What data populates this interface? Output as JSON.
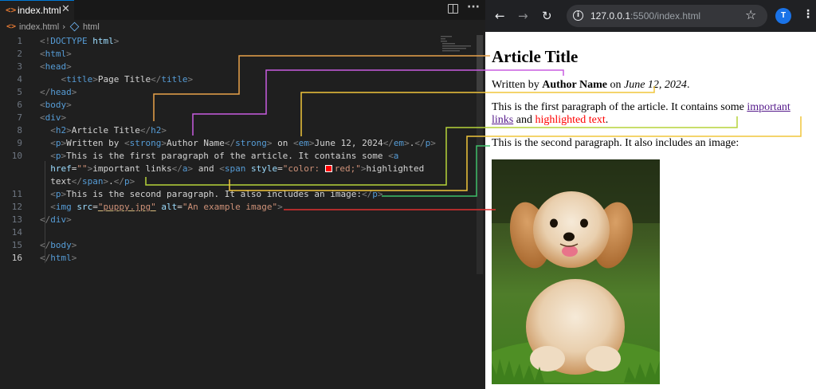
{
  "editor": {
    "tab": {
      "label": "index.html",
      "icon": "html-file-icon",
      "close": "✕"
    },
    "breadcrumb": {
      "file": "index.html",
      "separator": "›",
      "element": "html"
    },
    "lines": [
      {
        "num": "1",
        "parts": [
          [
            "br",
            "<!"
          ],
          [
            "tg",
            "DOCTYPE"
          ],
          [
            "tx",
            " "
          ],
          [
            "at",
            "html"
          ],
          [
            "br",
            ">"
          ]
        ]
      },
      {
        "num": "2",
        "parts": [
          [
            "br",
            "<"
          ],
          [
            "tg",
            "html"
          ],
          [
            "br",
            ">"
          ]
        ]
      },
      {
        "num": "3",
        "parts": [
          [
            "br",
            "<"
          ],
          [
            "tg",
            "head"
          ],
          [
            "br",
            ">"
          ]
        ]
      },
      {
        "num": "4",
        "parts": [
          [
            "tx",
            "    "
          ],
          [
            "br",
            "<"
          ],
          [
            "tg",
            "title"
          ],
          [
            "br",
            ">"
          ],
          [
            "tx",
            "Page Title"
          ],
          [
            "br",
            "</"
          ],
          [
            "tg",
            "title"
          ],
          [
            "br",
            ">"
          ]
        ]
      },
      {
        "num": "5",
        "parts": [
          [
            "br",
            "</"
          ],
          [
            "tg",
            "head"
          ],
          [
            "br",
            ">"
          ]
        ]
      },
      {
        "num": "6",
        "parts": [
          [
            "br",
            "<"
          ],
          [
            "tg",
            "body"
          ],
          [
            "br",
            ">"
          ]
        ]
      },
      {
        "num": "7",
        "parts": [
          [
            "br",
            "<"
          ],
          [
            "tg",
            "div"
          ],
          [
            "br",
            ">"
          ]
        ]
      },
      {
        "num": "8",
        "parts": [
          [
            "tx",
            "  "
          ],
          [
            "br",
            "<"
          ],
          [
            "tg",
            "h2"
          ],
          [
            "br",
            ">"
          ],
          [
            "tx",
            "Article Title"
          ],
          [
            "br",
            "</"
          ],
          [
            "tg",
            "h2"
          ],
          [
            "br",
            ">"
          ]
        ]
      },
      {
        "num": "9",
        "parts": [
          [
            "tx",
            "  "
          ],
          [
            "br",
            "<"
          ],
          [
            "tg",
            "p"
          ],
          [
            "br",
            ">"
          ],
          [
            "tx",
            "Written by "
          ],
          [
            "br",
            "<"
          ],
          [
            "tg",
            "strong"
          ],
          [
            "br",
            ">"
          ],
          [
            "tx",
            "Author Name"
          ],
          [
            "br",
            "</"
          ],
          [
            "tg",
            "strong"
          ],
          [
            "br",
            ">"
          ],
          [
            "tx",
            " on "
          ],
          [
            "br",
            "<"
          ],
          [
            "tg",
            "em"
          ],
          [
            "br",
            ">"
          ],
          [
            "tx",
            "June 12, 2024"
          ],
          [
            "br",
            "</"
          ],
          [
            "tg",
            "em"
          ],
          [
            "br",
            ">"
          ],
          [
            "tx",
            "."
          ],
          [
            "br",
            "</"
          ],
          [
            "tg",
            "p"
          ],
          [
            "br",
            ">"
          ]
        ]
      },
      {
        "num": "10",
        "parts": [
          [
            "tx",
            "  "
          ],
          [
            "br",
            "<"
          ],
          [
            "tg",
            "p"
          ],
          [
            "br",
            ">"
          ],
          [
            "tx",
            "This is the first paragraph of the article. It contains some "
          ],
          [
            "br",
            "<"
          ],
          [
            "tg",
            "a"
          ]
        ]
      },
      {
        "num": "",
        "parts": [
          [
            "tx",
            "  "
          ],
          [
            "at",
            "href"
          ],
          [
            "tx",
            "="
          ],
          [
            "st",
            "\"\""
          ],
          [
            "br",
            ">"
          ],
          [
            "tx",
            "important links"
          ],
          [
            "br",
            "</"
          ],
          [
            "tg",
            "a"
          ],
          [
            "br",
            ">"
          ],
          [
            "tx",
            " and "
          ],
          [
            "br",
            "<"
          ],
          [
            "tg",
            "span"
          ],
          [
            "tx",
            " "
          ],
          [
            "at",
            "style"
          ],
          [
            "tx",
            "="
          ],
          [
            "st",
            "\"color: "
          ],
          [
            "swatch",
            ""
          ],
          [
            "st",
            "red;\""
          ],
          [
            "br",
            ">"
          ],
          [
            "tx",
            "highlighted"
          ]
        ]
      },
      {
        "num": "",
        "parts": [
          [
            "tx",
            "  text"
          ],
          [
            "br",
            "</"
          ],
          [
            "tg",
            "span"
          ],
          [
            "br",
            ">"
          ],
          [
            "tx",
            "."
          ],
          [
            "br",
            "</"
          ],
          [
            "tg",
            "p"
          ],
          [
            "br",
            ">"
          ]
        ]
      },
      {
        "num": "11",
        "parts": [
          [
            "tx",
            "  "
          ],
          [
            "br",
            "<"
          ],
          [
            "tg",
            "p"
          ],
          [
            "br",
            ">"
          ],
          [
            "tx",
            "This is the second paragraph. It also includes an image:"
          ],
          [
            "br",
            "</"
          ],
          [
            "tg",
            "p"
          ],
          [
            "br",
            ">"
          ]
        ]
      },
      {
        "num": "12",
        "parts": [
          [
            "tx",
            "  "
          ],
          [
            "br",
            "<"
          ],
          [
            "tg",
            "img"
          ],
          [
            "tx",
            " "
          ],
          [
            "at",
            "src"
          ],
          [
            "tx",
            "="
          ],
          [
            "stu",
            "\"puppy.jpg\""
          ],
          [
            "tx",
            " "
          ],
          [
            "at",
            "alt"
          ],
          [
            "tx",
            "="
          ],
          [
            "st",
            "\"An example image\""
          ],
          [
            "br",
            ">"
          ]
        ]
      },
      {
        "num": "13",
        "parts": [
          [
            "br",
            "</"
          ],
          [
            "tg",
            "div"
          ],
          [
            "br",
            ">"
          ]
        ]
      },
      {
        "num": "14",
        "parts": []
      },
      {
        "num": "15",
        "parts": [
          [
            "br",
            "</"
          ],
          [
            "tg",
            "body"
          ],
          [
            "br",
            ">"
          ]
        ]
      },
      {
        "num": "16",
        "parts": [
          [
            "br",
            "</"
          ],
          [
            "tg",
            "html"
          ],
          [
            "br",
            ">"
          ]
        ]
      }
    ],
    "active_line": "16"
  },
  "browser": {
    "url_host": "127.0.0.1",
    "url_rest": ":5500/index.html",
    "avatar_letter": "T",
    "page": {
      "heading": "Article Title",
      "byline_prefix": "Written by ",
      "author": "Author Name",
      "byline_mid": " on ",
      "date": "June 12, 2024",
      "byline_end": ".",
      "p1_before": "This is the first paragraph of the article. It contains some ",
      "p1_link": "important links",
      "p1_and": " and ",
      "p1_highlight": "highlighted text",
      "p1_end": ".",
      "p2": "This is the second paragraph. It also includes an image:",
      "image_alt": "An example image"
    }
  },
  "colors": {
    "tag": "#569cd6",
    "attribute": "#9cdcfe",
    "string": "#ce9178",
    "connector_h2": "#e8a24a",
    "connector_strong": "#c95de0",
    "connector_em": "#f0c53c",
    "connector_link": "#b5d43a",
    "connector_span": "#f0c53c",
    "connector_p2": "#3fbf6a",
    "connector_img": "#e03030"
  }
}
